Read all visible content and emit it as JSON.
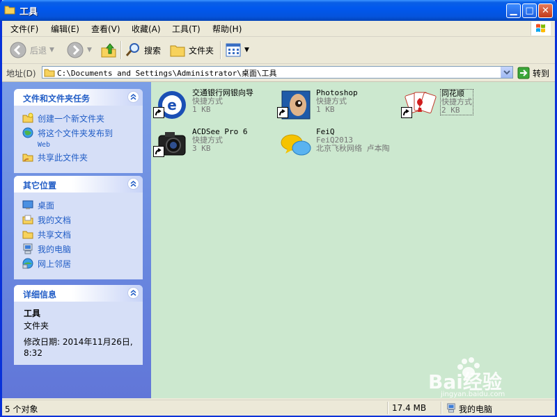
{
  "window": {
    "title": "工具"
  },
  "menu": [
    {
      "label": "文件(F)"
    },
    {
      "label": "编辑(E)"
    },
    {
      "label": "查看(V)"
    },
    {
      "label": "收藏(A)"
    },
    {
      "label": "工具(T)"
    },
    {
      "label": "帮助(H)"
    }
  ],
  "toolbar": {
    "back": "后退",
    "search": "搜索",
    "folders": "文件夹"
  },
  "address": {
    "label": "地址(D)",
    "path": "C:\\Documents and Settings\\Administrator\\桌面\\工具",
    "go": "转到"
  },
  "tasks": {
    "title": "文件和文件夹任务",
    "items": [
      {
        "label": "创建一个新文件夹",
        "icon": "new-folder-icon"
      },
      {
        "label": "将这个文件夹发布到",
        "sub": "Web",
        "icon": "publish-web-icon"
      },
      {
        "label": "共享此文件夹",
        "icon": "share-folder-icon"
      }
    ]
  },
  "places": {
    "title": "其它位置",
    "items": [
      {
        "label": "桌面",
        "icon": "desktop-icon"
      },
      {
        "label": "我的文档",
        "icon": "my-documents-icon"
      },
      {
        "label": "共享文档",
        "icon": "shared-documents-icon"
      },
      {
        "label": "我的电脑",
        "icon": "my-computer-icon"
      },
      {
        "label": "网上邻居",
        "icon": "network-places-icon"
      }
    ]
  },
  "details": {
    "title": "详细信息",
    "name": "工具",
    "type": "文件夹",
    "modified": "修改日期: 2014年11月26日,",
    "time": "8:32"
  },
  "files": [
    {
      "name": "交通银行网银向导",
      "type": "快捷方式",
      "size": "1 KB",
      "icon": "bank-ie-icon"
    },
    {
      "name": "Photoshop",
      "type": "快捷方式",
      "size": "1 KB",
      "icon": "photoshop-icon"
    },
    {
      "name": "同花顺",
      "type": "快捷方式",
      "size": "2 KB",
      "icon": "cards-icon"
    },
    {
      "name": "ACDSee Pro 6",
      "type": "快捷方式",
      "size": "3 KB",
      "icon": "camera-icon"
    },
    {
      "name": "FeiQ",
      "type": "FeiQ2013",
      "size": "北京飞秋网络 卢本陶",
      "icon": "feiq-icon"
    }
  ],
  "status": {
    "count": "5 个对象",
    "size": "17.4 MB",
    "location": "我的电脑"
  },
  "watermark": {
    "text": "Bai经验",
    "url": "jingyan.baidu.com"
  }
}
